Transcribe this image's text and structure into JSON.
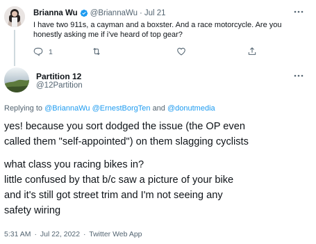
{
  "parent_tweet": {
    "author_name": "Brianna Wu",
    "handle": "@BriannaWu",
    "separator": "·",
    "date": "Jul 21",
    "text": "I have two 911s, a cayman and a boxster. And a race motorcycle. Are you honestly asking me if i've heard of top gear?",
    "reply_count": "1",
    "more_icon": "ellipsis-icon"
  },
  "reply_tweet": {
    "author_name": "Partition 12",
    "handle": "@12Partition",
    "replying_to_prefix": "Replying to",
    "mentions": [
      "@BriannaWu",
      "@ErnestBorgTen",
      "@donutmedia"
    ],
    "mentions_joiner": "and",
    "paragraph_1": "yes! because you sort dodged the issue (the OP even\ncalled them \"self-appointed\") on them slagging cyclists",
    "paragraph_2": "what class you racing bikes in?\nlittle confused by that b/c saw a picture of your bike\nand it's still got street trim and I'm not seeing any\nsafety wiring",
    "time": "5:31 AM",
    "separator": "·",
    "date": "Jul 22, 2022",
    "client": "Twitter Web App"
  },
  "colors": {
    "text_primary": "#0f1419",
    "text_secondary": "#536471",
    "link": "#1d9bf0",
    "verified": "#1d9bf0",
    "thread_line": "#cfd9de"
  }
}
